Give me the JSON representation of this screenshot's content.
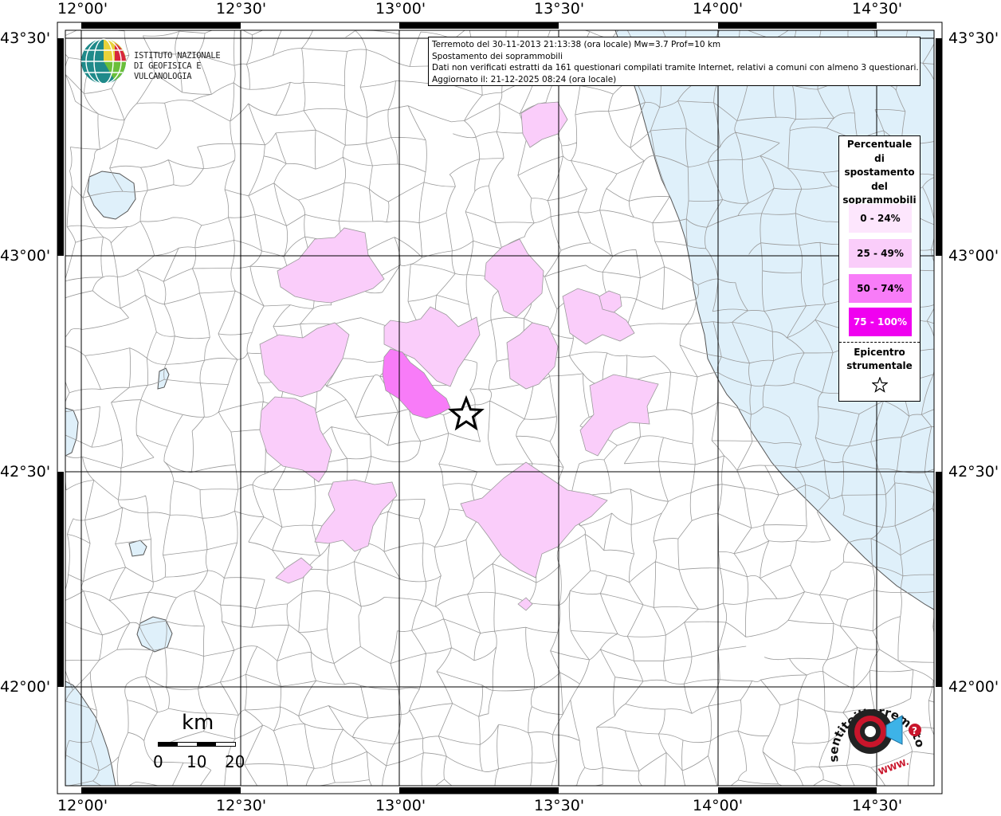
{
  "info_box": {
    "line1": "Terremoto del 30-11-2013 21:13:38 (ora locale) Mw=3.7 Prof=10 km",
    "line2": "Spostamento dei soprammobili",
    "line3": "Dati non verificati estratti da 161 questionari compilati tramite Internet, relativi a comuni con almeno 3 questionari.",
    "line4": "Aggiornato il: 21-12-2025 08:24 (ora locale)"
  },
  "logo": {
    "line1": "ISTITUTO NAZIONALE",
    "line2": "DI GEOFISICA E VULCANOLOGIA"
  },
  "coords": {
    "top": [
      "12°00'",
      "12°30'",
      "13°00'",
      "13°30'",
      "14°00'",
      "14°30'"
    ],
    "bottom": [
      "12°00'",
      "12°30'",
      "13°00'",
      "13°30'",
      "14°00'",
      "14°30'"
    ],
    "left": [
      "43°30'",
      "43°00'",
      "42°30'",
      "42°00'"
    ],
    "right": [
      "43°30'",
      "43°00'",
      "42°30'",
      "42°00'"
    ]
  },
  "legend": {
    "title_lines": [
      "Percentuale",
      "di",
      "spostamento",
      "del",
      "soprammobili"
    ],
    "classes": [
      {
        "label": "0 - 24%",
        "color": "#fde6fd"
      },
      {
        "label": "25 - 49%",
        "color": "#facdfa"
      },
      {
        "label": "50 - 74%",
        "color": "#f87cf8"
      },
      {
        "label": "75 - 100%",
        "color": "#f000f0"
      }
    ],
    "epicenter_lines": [
      "Epicentro",
      "strumentale"
    ]
  },
  "scale": {
    "title": "km",
    "labels": [
      "0",
      "10",
      "20"
    ]
  },
  "sentito_logo": {
    "text": "sentitoilterremoto.it",
    "url_text": "WWW.",
    "mark": "?"
  },
  "colors": {
    "sea": "#dff0fa",
    "border": "#7a7a7a",
    "grid": "#000000"
  }
}
